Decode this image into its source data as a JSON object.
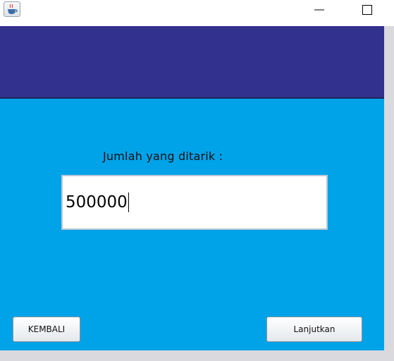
{
  "window": {
    "icon": "java-cup-icon",
    "controls": [
      "minimize-icon",
      "maximize-icon"
    ]
  },
  "form": {
    "label": "Jumlah yang ditarik :",
    "amount_value": "500000"
  },
  "buttons": {
    "back_label": "KEMBALI",
    "next_label": "Lanjutkan"
  },
  "colors": {
    "header_band": "#32318e",
    "content_bg": "#00a2e8"
  }
}
